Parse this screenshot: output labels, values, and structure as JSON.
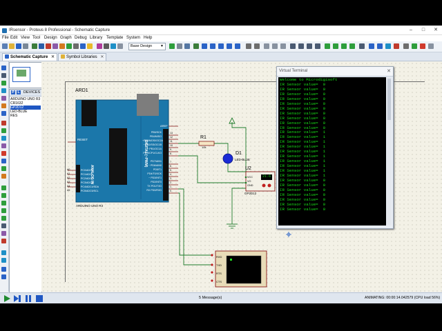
{
  "window": {
    "title": "IRsensor - Proteus 8 Professional - Schematic Capture",
    "controls": [
      "–",
      "□",
      "✕"
    ]
  },
  "menu": [
    "File",
    "Edit",
    "View",
    "Tool",
    "Design",
    "Graph",
    "Debug",
    "Library",
    "Template",
    "System",
    "Help"
  ],
  "toolbar": {
    "design_select": "Base Design",
    "colors": {
      "blue": "#2a63c7",
      "green": "#2e9e3c",
      "red": "#d03a2c",
      "yellow": "#e8b92a",
      "grey": "#8892a0"
    }
  },
  "tabs": [
    {
      "label": "Schematic Capture",
      "active": true
    },
    {
      "label": "Symbol Libraries",
      "active": false
    }
  ],
  "device_panel": {
    "p_label": "P",
    "l_label": "L",
    "header": "DEVICES",
    "items": [
      {
        "label": "ARDUINO UNO R3",
        "selected": false
      },
      {
        "label": "CR1632",
        "selected": false
      },
      {
        "label": "GP2D12",
        "selected": true
      },
      {
        "label": "LED-BLUE",
        "selected": false
      },
      {
        "label": "RES",
        "selected": false
      }
    ]
  },
  "schematic": {
    "arduino": {
      "ref": "ARD1",
      "part": "ARDUINO UNO R3",
      "reset_label": "RESET",
      "analog_label": "ANALOG IN",
      "digital_label": "DIGITAL (~PWM)",
      "aref": "AREF",
      "digital_pins": [
        "PB5/SCK",
        "PB4/MISO",
        "~PB3/MOSI/OC2A",
        "~ PB2/SS/OC1B",
        "~ PB1/OC1A",
        "PB0/ICP1/CLKO",
        "PD7/AIN1",
        "~ PD6/AIN0",
        "PD5/T1",
        "PD4/T0/XCK",
        "~ PD3/INT1",
        "PD2/INT0",
        "TX PD1/TXD",
        "RX PD0/RXD"
      ],
      "digital_numbers": [
        "13",
        "12",
        "11",
        "10",
        "9",
        "8",
        "7",
        "6",
        "5",
        "4",
        "3",
        "2",
        "1",
        "0"
      ],
      "analog_pins": [
        "PC0/ADC0",
        "PC1/ADC1",
        "PC2/ADC2",
        "PC3/ADC3",
        "PC4/ADC4/SDA",
        "PC5/ADC5/SCL"
      ],
      "analog_numbers": [
        "A0",
        "A1",
        "A2",
        "A3",
        "A4",
        "A5"
      ]
    },
    "resistor": {
      "ref": "R1",
      "value": "10k"
    },
    "led": {
      "ref": "D1",
      "part": "LED-BLUE"
    },
    "sensor": {
      "ref": "U2",
      "part": "GP2D12",
      "pins": [
        "VCC",
        "VO",
        "GND"
      ],
      "readout": "21.6"
    },
    "terminal": {
      "pins": [
        "RXD",
        "TXD",
        "RTS",
        "CTS"
      ]
    }
  },
  "virtual_terminal": {
    "title": "Virtual Terminal",
    "lines": [
      "Welcome to Microdigisoft",
      "IR Sensor value=  0",
      "IR Sensor value=  0",
      "IR Sensor value=  0",
      "IR Sensor value=  0",
      "IR Sensor value=  0",
      "IR Sensor value=  0",
      "IR Sensor value=  0",
      "IR Sensor value=  0",
      "IR Sensor value=  0",
      "IR Sensor value=  0",
      "IR Sensor value=  1",
      "IR Sensor value=  1",
      "IR Sensor value=  1",
      "IR Sensor value=  1",
      "IR Sensor value=  1",
      "IR Sensor value=  1",
      "IR Sensor value=  1",
      "IR Sensor value=  1",
      "IR Sensor value=  1",
      "IR Sensor value=  1",
      "IR Sensor value=  0",
      "IR Sensor value=  0",
      "IR Sensor value=  0",
      "IR Sensor value=  0",
      "IR Sensor value=  0",
      "IR Sensor value=  0",
      "IR Sensor value=  0"
    ]
  },
  "status": {
    "messages": "5 Message(s)",
    "animation": "ANIMATING: 00:00:14.042579 (CPU load 56%)"
  }
}
